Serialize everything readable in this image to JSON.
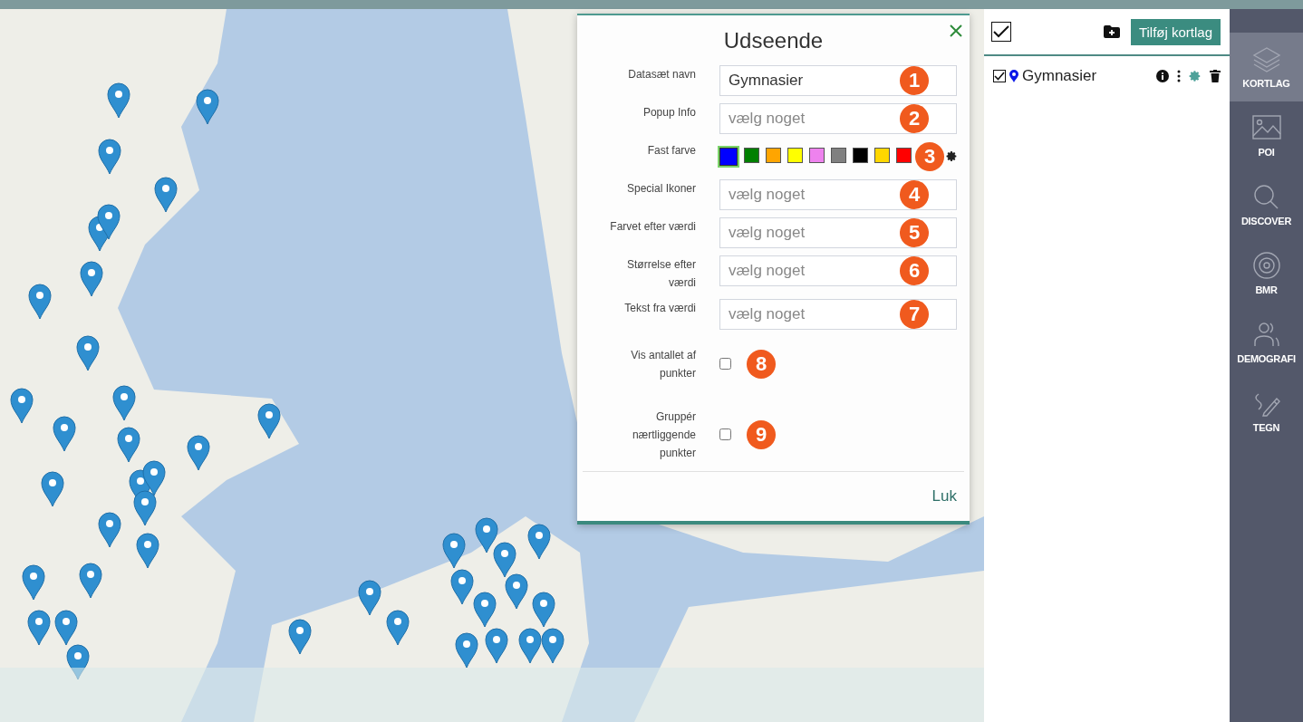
{
  "dialog": {
    "title": "Udseende",
    "fields": [
      {
        "kind": "text",
        "label": "Datasæt navn",
        "value": "Gymnasier",
        "badge": "1"
      },
      {
        "kind": "select",
        "label": "Popup Info",
        "placeholder": "vælg noget",
        "badge": "2"
      },
      {
        "kind": "colors",
        "label": "Fast farve",
        "badge": "3",
        "swatches": [
          {
            "color": "#0000ff",
            "selected": true
          },
          {
            "color": "#008000",
            "selected": false
          },
          {
            "color": "#ffa500",
            "selected": false
          },
          {
            "color": "#ffff00",
            "selected": false
          },
          {
            "color": "#ee82ee",
            "selected": false
          },
          {
            "color": "#808080",
            "selected": false
          },
          {
            "color": "#000000",
            "selected": false
          },
          {
            "color": "#ffd700",
            "selected": false
          },
          {
            "color": "#ff0000",
            "selected": false
          }
        ]
      },
      {
        "kind": "select",
        "label": "Special Ikoner",
        "placeholder": "vælg noget",
        "badge": "4"
      },
      {
        "kind": "select",
        "label": "Farvet efter værdi",
        "placeholder": "vælg noget",
        "badge": "5"
      },
      {
        "kind": "select",
        "label": "Størrelse efter værdi",
        "placeholder": "vælg noget",
        "badge": "6"
      },
      {
        "kind": "select",
        "label": "Tekst fra værdi",
        "placeholder": "vælg noget",
        "badge": "7"
      },
      {
        "kind": "checkbox",
        "label": "Vis antallet af punkter",
        "checked": false,
        "badge": "8"
      },
      {
        "kind": "checkbox",
        "label": "Gruppér nærtliggende punkter",
        "checked": false,
        "badge": "9"
      }
    ],
    "close_button": "Luk"
  },
  "layers_panel": {
    "select_all_checked": true,
    "add_button": "Tilføj kortlag",
    "layers": [
      {
        "name": "Gymnasier",
        "checked": true
      }
    ]
  },
  "nav": [
    {
      "label": "KORTLAG",
      "selected": true
    },
    {
      "label": "POI",
      "selected": false
    },
    {
      "label": "DISCOVER",
      "selected": false
    },
    {
      "label": "BMR",
      "selected": false
    },
    {
      "label": "DEMOGRAFI",
      "selected": false
    },
    {
      "label": "TEGN",
      "selected": false
    }
  ]
}
